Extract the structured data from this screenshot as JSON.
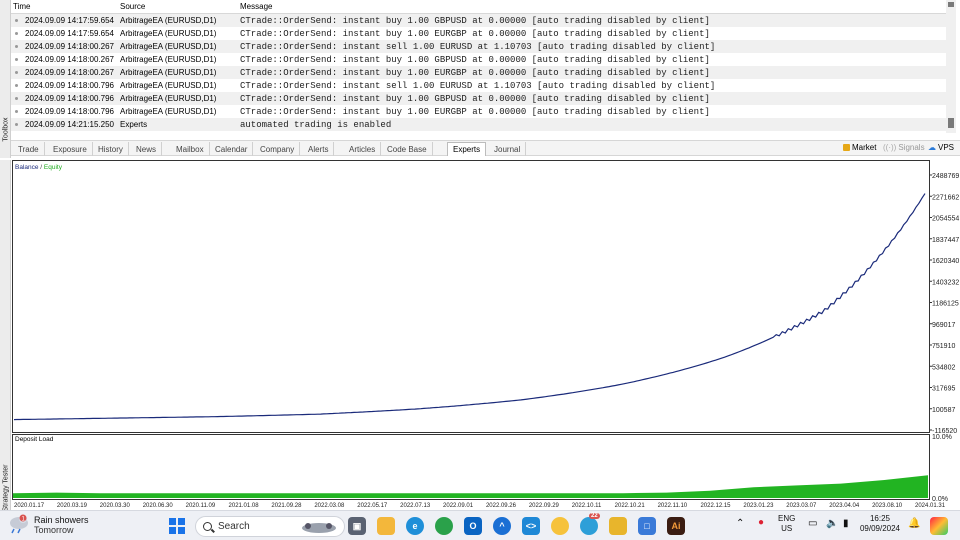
{
  "journal": {
    "columns": [
      "Time",
      "Source",
      "Message"
    ],
    "rows": [
      {
        "time": "2024.09.09 14:17:59.654",
        "source": "ArbitrageEA (EURUSD,D1)",
        "message": "CTrade::OrderSend: instant buy 1.00 GBPUSD at 0.00000 [auto trading disabled by client]"
      },
      {
        "time": "2024.09.09 14:17:59.654",
        "source": "ArbitrageEA (EURUSD,D1)",
        "message": "CTrade::OrderSend: instant buy 1.00 EURGBP at 0.00000 [auto trading disabled by client]"
      },
      {
        "time": "2024.09.09 14:18:00.267",
        "source": "ArbitrageEA (EURUSD,D1)",
        "message": "CTrade::OrderSend: instant sell 1.00 EURUSD at 1.10703 [auto trading disabled by client]"
      },
      {
        "time": "2024.09.09 14:18:00.267",
        "source": "ArbitrageEA (EURUSD,D1)",
        "message": "CTrade::OrderSend: instant buy 1.00 GBPUSD at 0.00000 [auto trading disabled by client]"
      },
      {
        "time": "2024.09.09 14:18:00.267",
        "source": "ArbitrageEA (EURUSD,D1)",
        "message": "CTrade::OrderSend: instant buy 1.00 EURGBP at 0.00000 [auto trading disabled by client]"
      },
      {
        "time": "2024.09.09 14:18:00.796",
        "source": "ArbitrageEA (EURUSD,D1)",
        "message": "CTrade::OrderSend: instant sell 1.00 EURUSD at 1.10703 [auto trading disabled by client]"
      },
      {
        "time": "2024.09.09 14:18:00.796",
        "source": "ArbitrageEA (EURUSD,D1)",
        "message": "CTrade::OrderSend: instant buy 1.00 GBPUSD at 0.00000 [auto trading disabled by client]"
      },
      {
        "time": "2024.09.09 14:18:00.796",
        "source": "ArbitrageEA (EURUSD,D1)",
        "message": "CTrade::OrderSend: instant buy 1.00 EURGBP at 0.00000 [auto trading disabled by client]"
      },
      {
        "time": "2024.09.09 14:21:15.250",
        "source": "Experts",
        "message": "automated trading is enabled"
      }
    ]
  },
  "sidebar": {
    "toolbox_label": "Toolbox",
    "tester_label": "Strategy Tester"
  },
  "tabs": [
    "Trade",
    "Exposure",
    "History",
    "News",
    "Mailbox",
    "Calendar",
    "Company",
    "Alerts",
    "Articles",
    "Code Base",
    "Experts",
    "Journal"
  ],
  "active_tab": "Experts",
  "right_tabs": {
    "market": "Market",
    "signals": "Signals",
    "vps": "VPS"
  },
  "colors": {
    "balance": "#1a2a7a",
    "equity": "#1eaa1e",
    "deposit_load": "#22b422",
    "selected_tab_border": "#bcbcbc"
  },
  "chart_data": [
    {
      "type": "line",
      "legend": {
        "balance": "Balance",
        "separator": " / ",
        "equity": "Equity"
      },
      "series": [
        {
          "name": "Balance",
          "x": [
            "2020.01.17",
            "2020.06.30",
            "2021.01.08",
            "2021.09.28",
            "2022.05.17",
            "2022.09.29",
            "2022.12.15",
            "2023.03.07",
            "2023.08.10",
            "2024.01.31"
          ],
          "values": [
            -10000,
            5000,
            20000,
            45000,
            100000,
            190000,
            350000,
            620000,
            1100000,
            2300000
          ]
        }
      ],
      "yticks": [
        "2488769",
        "2271662",
        "2054554",
        "1837447",
        "1620340",
        "1403232",
        "1186125",
        "969017",
        "751910",
        "534802",
        "317695",
        "100587",
        "-116520"
      ],
      "ylim": [
        -116520,
        2488769
      ]
    },
    {
      "type": "area",
      "title": "Deposit Load",
      "yticks": [
        "10.0%",
        "0.0%"
      ],
      "xticks": [
        "2020.01.17",
        "2020.03.19",
        "2020.03.30",
        "2020.06.30",
        "2020.11.09",
        "2021.01.08",
        "2021.09.28",
        "2022.03.08",
        "2022.05.17",
        "2022.07.13",
        "2022.09.01",
        "2022.09.26",
        "2022.09.29",
        "2022.10.11",
        "2022.10.21",
        "2022.11.10",
        "2022.12.15",
        "2023.01.23",
        "2023.03.07",
        "2023.04.04",
        "2023.08.10",
        "2024.01.31"
      ],
      "values_percent": [
        0.8,
        0.9,
        0.8,
        0.8,
        0.8,
        0.8,
        0.8,
        0.8,
        0.8,
        0.8,
        0.8,
        0.8,
        0.8,
        0.8,
        0.8,
        0.9,
        1.2,
        1.8,
        2.1,
        2.4,
        3.0,
        3.8
      ],
      "ylim": [
        0,
        10
      ]
    }
  ],
  "taskbar": {
    "weather_line1": "Rain showers",
    "weather_line2": "Tomorrow",
    "search_placeholder": "Search",
    "lang_line1": "ENG",
    "lang_line2": "US",
    "time": "16:25",
    "date": "09/09/2024",
    "badge_count": "1",
    "badge_count2": "22"
  }
}
